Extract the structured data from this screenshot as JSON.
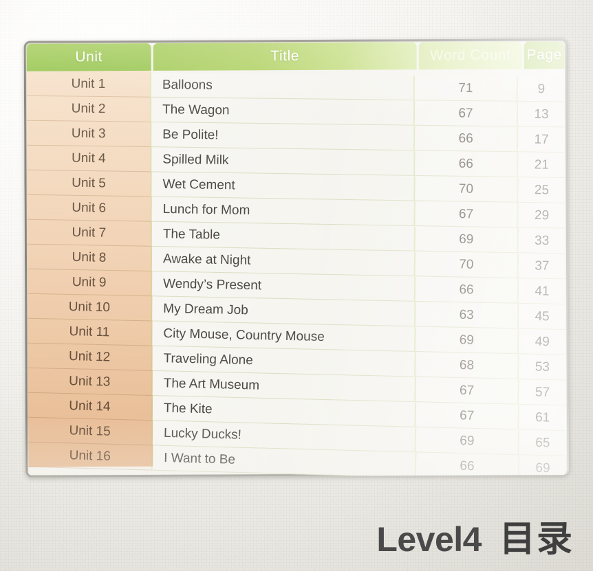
{
  "caption": {
    "level": "Level4",
    "section": "目录"
  },
  "table": {
    "columns": [
      {
        "key": "unit",
        "label": "Unit"
      },
      {
        "key": "title",
        "label": "Title"
      },
      {
        "key": "words",
        "label": "Word Count"
      },
      {
        "key": "page",
        "label": "Page"
      }
    ],
    "rows": [
      {
        "unit": "Unit 1",
        "title": "Balloons",
        "words": "71",
        "page": "9"
      },
      {
        "unit": "Unit 2",
        "title": "The Wagon",
        "words": "67",
        "page": "13"
      },
      {
        "unit": "Unit 3",
        "title": "Be Polite!",
        "words": "66",
        "page": "17"
      },
      {
        "unit": "Unit 4",
        "title": "Spilled Milk",
        "words": "66",
        "page": "21"
      },
      {
        "unit": "Unit 5",
        "title": "Wet Cement",
        "words": "70",
        "page": "25"
      },
      {
        "unit": "Unit 6",
        "title": "Lunch for Mom",
        "words": "67",
        "page": "29"
      },
      {
        "unit": "Unit 7",
        "title": "The Table",
        "words": "69",
        "page": "33"
      },
      {
        "unit": "Unit 8",
        "title": "Awake at Night",
        "words": "70",
        "page": "37"
      },
      {
        "unit": "Unit 9",
        "title": "Wendy’s Present",
        "words": "66",
        "page": "41"
      },
      {
        "unit": "Unit 10",
        "title": "My Dream Job",
        "words": "63",
        "page": "45"
      },
      {
        "unit": "Unit 11",
        "title": "City Mouse, Country Mouse",
        "words": "69",
        "page": "49"
      },
      {
        "unit": "Unit 12",
        "title": "Traveling Alone",
        "words": "68",
        "page": "53"
      },
      {
        "unit": "Unit 13",
        "title": "The Art Museum",
        "words": "67",
        "page": "57"
      },
      {
        "unit": "Unit 14",
        "title": "The Kite",
        "words": "67",
        "page": "61"
      },
      {
        "unit": "Unit 15",
        "title": "Lucky Ducks!",
        "words": "69",
        "page": "65"
      },
      {
        "unit": "Unit 16",
        "title": "I Want to Be",
        "words": "66",
        "page": "69"
      }
    ]
  },
  "colors": {
    "header_green": "#a8cd60",
    "header_green_light": "#d8e9a5",
    "unit_peach": "#f4d9bd",
    "cell_cream": "#f5f4ef",
    "text_dark": "#4e4a44",
    "caption_gray": "#4a4a4a",
    "frame_gray": "#6c6860",
    "background_paper": "#f2f1ec"
  }
}
